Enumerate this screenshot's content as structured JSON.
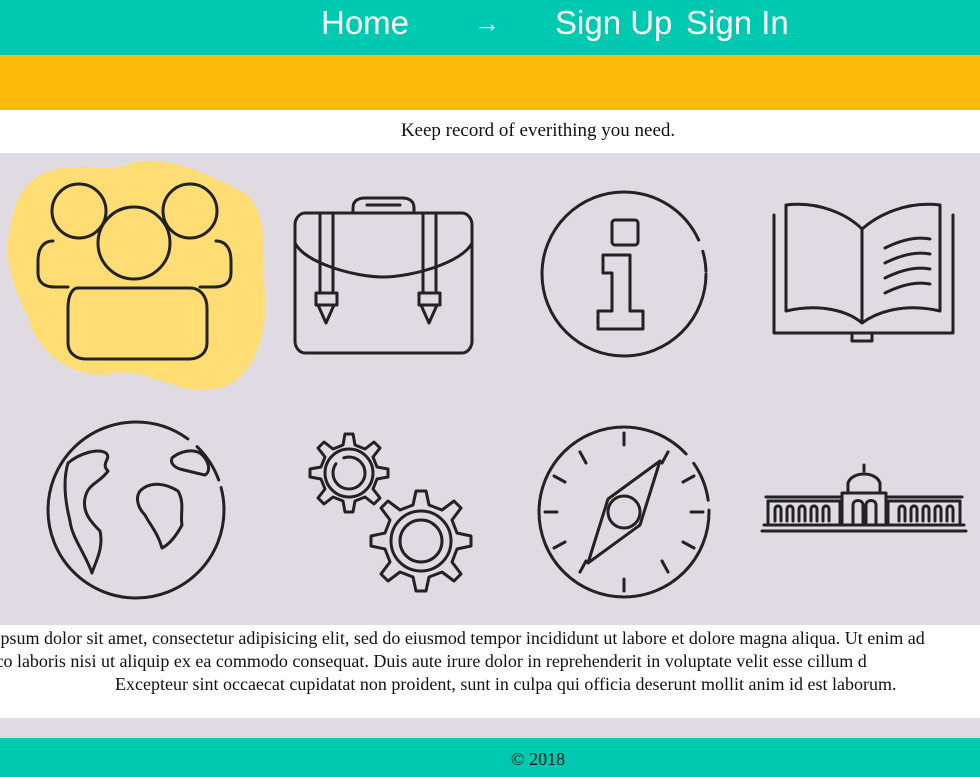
{
  "nav": {
    "home": "Home",
    "arrow": "→",
    "signup": "Sign Up",
    "signin": "Sign In"
  },
  "tagline": "Keep record of everithing you need.",
  "icons": [
    "users-icon",
    "briefcase-icon",
    "info-icon",
    "book-icon",
    "globe-icon",
    "gears-icon",
    "compass-icon",
    "building-icon"
  ],
  "lorem": {
    "line1": "Lorem ipsum dolor sit amet, consectetur adipisicing elit, sed do eiusmod tempor incididunt ut labore et dolore magna aliqua. Ut enim ad",
    "line2": "quis nostrud exercitation ullamco laboris nisi ut aliquip ex ea commodo consequat. Duis aute irure dolor in reprehenderit in voluptate velit esse cillum d",
    "line3": "Excepteur sint occaecat cupidatat non proident, sunt in culpa qui officia deserunt mollit anim id est laborum."
  },
  "footer": "© 2018",
  "colors": {
    "teal": "#00C9B2",
    "yellow": "#FDBC0B",
    "lavender": "#E0DAE3",
    "highlight": "#FFDD75",
    "ink": "#222222"
  }
}
